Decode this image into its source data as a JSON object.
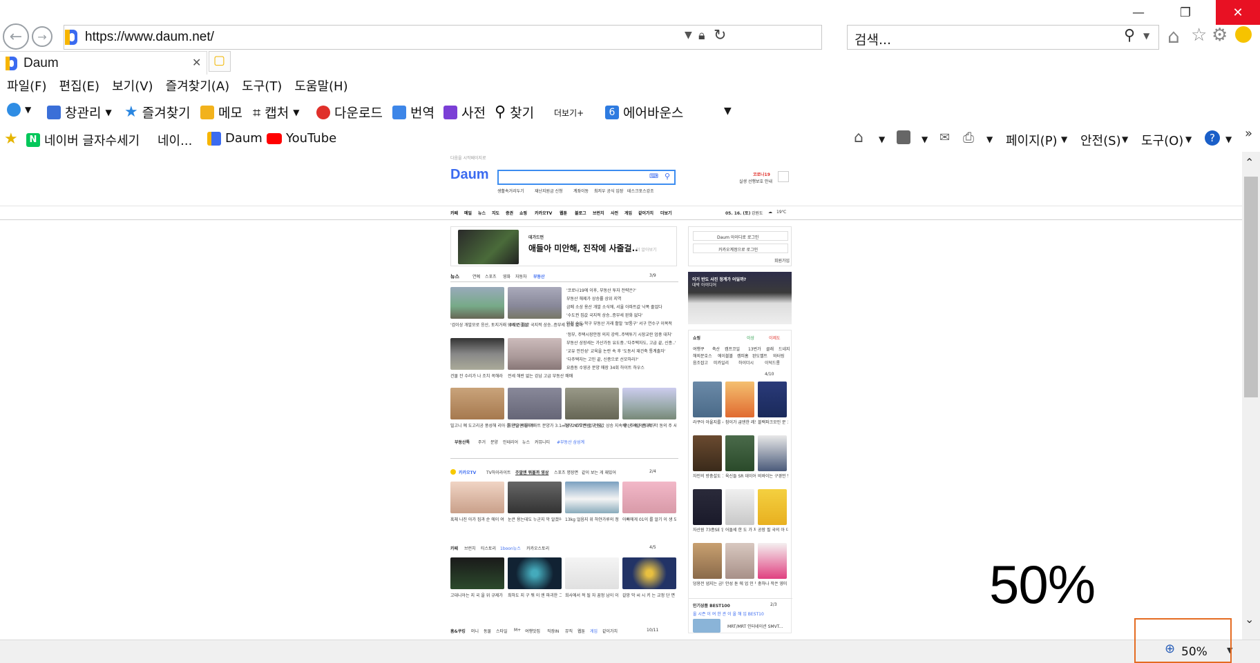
{
  "browser": {
    "url": "https://www.daum.net/",
    "search_placeholder": "검색...",
    "tab_title": "Daum",
    "menu": [
      "파일(F)",
      "편집(E)",
      "보기(V)",
      "즐겨찾기(A)",
      "도구(T)",
      "도움말(H)"
    ],
    "toolbar": {
      "window_mgmt": "창관리",
      "favorites": "즐겨찾기",
      "memo": "메모",
      "capture": "캡처",
      "download": "다운로드",
      "translate": "번역",
      "dictionary": "사전",
      "find": "찾기",
      "more": "더보기+",
      "airbounce": "에어바운스"
    },
    "favorites_bar": {
      "naver": "네이버 글자수세기",
      "naver2": "네이...",
      "daum": "Daum",
      "youtube": "YouTube"
    },
    "commands": {
      "page": "페이지(P)",
      "safety": "안전(S)",
      "tools": "도구(O)"
    },
    "zoom_level": "50%",
    "zoom_overlay": "50%"
  },
  "daum": {
    "top_link": "다음을 시작페이지로",
    "search_tags": [
      "생활속거리두기",
      "재난지원금 신청",
      "계좌이동",
      "최저우 공식 입장",
      "테스크포스강조"
    ],
    "weather_promo": "코로나19",
    "weather_sub": "실생 선행보호 안내",
    "nav": [
      "카페",
      "메일",
      "뉴스",
      "지도",
      "증권",
      "쇼핑",
      "카카오TV",
      "웹툰",
      "블로그",
      "브런치",
      "사전",
      "게임",
      "같이가치",
      "더보기"
    ],
    "date": "05. 16. (토)",
    "region": "강원도",
    "temp": "19℃",
    "ad_brand": "데가드먼",
    "ad_text": "애들아 미안해, 진작에 사줄걸..",
    "ad_sub": "더 알아보기",
    "login_btn": "Daum 아이디로 로그인",
    "kakao_login": "카카오계정으로 로그인",
    "signup": "회원가입",
    "news_tabs": [
      "뉴스",
      "연예",
      "스포츠",
      "영화",
      "자동차",
      "부동산"
    ],
    "news_page": "3/9",
    "headlines": [
      "'코로나19에 이후, 부동산 투자 전략은?'",
      "부동산 해제가 상승률 상위 지역",
      "금메 소상 용산 개발 소식에, 서울 아파트값 낙폭 줄었다",
      "'수도권 집값 국지적 상승..증부세 완화 없다'",
      "인천 송도 학구 부동산 거래 활발 '보통구' 서구 연수구 이목적",
      "'정부, 주택시장안정 의지 강력..주택투기 시장교란 엄중 대처'",
      "부동산 상장세는 가산가등 유도중..'다주택자도, 고급 끝, 신종..'",
      "'교유 안진성' 교육을 논란 속 후 '도동서 재건축 통계출자'",
      "'다주택자는 고민 끝, 신종으로 선모하라?'",
      "요즘동 수영공 분양 매장 34회 하이트 하우스"
    ],
    "img_captions": [
      "'검이상 개발모로 응산, 토지거래 규제로 풀상'",
      "'수도권 집값 국지적 상승..증부세 완화 없다'",
      "건물 잔 수리가 나 조치 꼭해라",
      "전세 해란 없는 강남 고급 부동산 매매",
      "빌고니 예 도고리공 풍성해 리아 를 연술펀아파트",
      "지난달 서울 아파트 분양가 3.1㎡당 '2677만원'. 전국",
      "정부 '수도권 일부 집값 상승 지속세'..추속 의정 촉구",
      "'용산 개발 반대로 각 동의 주 새로..'토지거래 허가구역 지"
    ],
    "bottom_tags_label": "부동산톡",
    "bottom_tags": [
      "주거",
      "분양",
      "인테리어",
      "뉴스",
      "커뮤니티"
    ],
    "bottom_highlight": "#부동산 삼성계",
    "kakaotv_title": "카카오TV",
    "kakaotv_tabs": [
      "TV하이라이트",
      "주말엔 뭐볼까 영상",
      "스포츠 명장면",
      "같이 보는 게 재밌어"
    ],
    "kakaotv_page": "2/4",
    "kakaotv_captions": [
      "혹체 나진 아가 집과 순 에이 여 대비한 스티",
      "눈큰 용는데도 누군지 막 알겠어",
      "13kg 얼음지 위 하얀가루의 정체",
      "아빠에게 01이 를 알기 이 생 도 수 있 는 일"
    ],
    "cafe_tabs": [
      "카페",
      "브런치",
      "티스토리",
      "1boon뉴스",
      "카카오스토리"
    ],
    "cafe_page": "4/5",
    "cafe_captions": [
      "고대니아는 지 국 을 위 규제가 누등 해 지고 있다",
      "최하도 지 구 뭐 이 엔 파괴한 그 우 주 생 에 기",
      "희사에서 적 될 자 꿈정 남이 이 도 사 장 중 의 이",
      "갈망 막 씨 시 키 는 교정 단 면 적 체 료"
    ],
    "more_tabs": [
      "홈&쿠킹",
      "머니",
      "동물",
      "스타일",
      "M+",
      "여행맛집",
      "직장IN",
      "뮤직",
      "웹툰",
      "게임",
      "같이가치"
    ],
    "more_page": "10/11",
    "promo_banner": "이거 반도 사진 정계가 어딜까?",
    "promo_sub": "대박 아이디어",
    "shopping": "쇼핑",
    "shop_opt1": "이상",
    "shop_opt2": "이제도",
    "shop_cats": [
      "여행쿠",
      "축산",
      "캠프코일",
      "13번가",
      "클래",
      "드네지",
      "해외문호스",
      "에이블볼",
      "캠피홈",
      "완도멜트",
      "와터링",
      "음조잡고",
      "미카일리",
      "하이더시",
      "이덕드롱"
    ],
    "shop_page": "4/10",
    "shop_items": [
      "라쿠아 아울지를 새일가 시관은..",
      "참이가 굽덴한 레드 오일 론색",
      "블랙파크모인 문 프리텐 80%",
      "자민의 방충설도 100%공토시",
      "육신들 SR 데이어 가는..",
      "비바이는 구경언 빙드난 오일 제일",
      "자산원 73종SE 입제라이콘성지",
      "어돌세 한 도 가 지 지점 화이지 기",
      "공장 필 국의 아 대 작 진 중",
      "덩용전 냅지는 금팬들을 빼 냉",
      "안성 돋 에 업 인 팬들을 트 팬",
      "충하나 작은 영미 다 모킨"
    ],
    "best_title": "인기상품 BEST100",
    "best_page": "2/3",
    "best_sub": "올 시즌 이 여 한 관 이 올 해 입 BEST10",
    "best_item": "MRT/MRT 인터네이션 SMVT..."
  }
}
